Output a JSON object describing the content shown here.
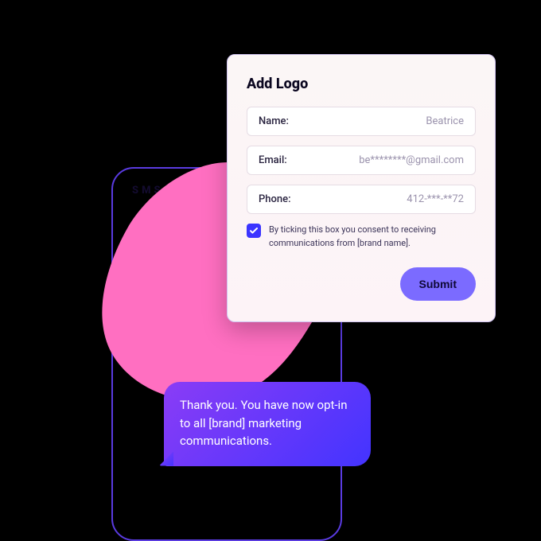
{
  "phone": {
    "header_label": "SMS"
  },
  "form": {
    "title": "Add Logo",
    "fields": {
      "name": {
        "label": "Name:",
        "value": "Beatrice"
      },
      "email": {
        "label": "Email:",
        "value": "be********@gmail.com"
      },
      "phone": {
        "label": "Phone:",
        "value": "412-***-**72"
      }
    },
    "consent": {
      "checked": true,
      "text": "By ticking this box you consent to receiving communications from [brand name]."
    },
    "submit_label": "Submit"
  },
  "chat": {
    "message": "Thank you. You have now opt-in to all [brand] marketing communications."
  },
  "colors": {
    "accent": "#7b6bff",
    "checkbox": "#3b34ff",
    "blob": "#ff6fc1",
    "frame_border": "#5a3be0"
  }
}
